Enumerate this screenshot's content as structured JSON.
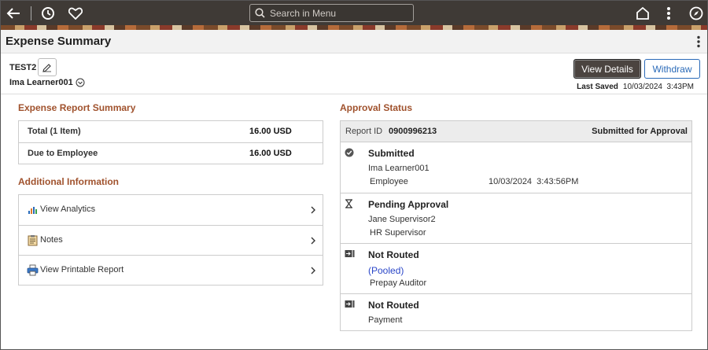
{
  "topbar": {
    "icons": [
      "back-arrow-icon",
      "history-icon",
      "heart-icon",
      "home-icon",
      "kebab-icon",
      "compass-icon"
    ],
    "search_placeholder": "Search in Menu"
  },
  "page": {
    "title": "Expense Summary"
  },
  "header": {
    "report_name": "TEST2",
    "employee": "Ima Learner001",
    "view_details_label": "View Details",
    "withdraw_label": "Withdraw",
    "last_saved_label": "Last Saved",
    "last_saved_value": "10/03/2024  3:43PM"
  },
  "summary": {
    "heading": "Expense Report Summary",
    "rows": [
      {
        "label": "Total (1 Item)",
        "value": "16.00 USD"
      },
      {
        "label": "Due to Employee",
        "value": "16.00 USD"
      }
    ]
  },
  "additional": {
    "heading": "Additional Information",
    "items": [
      {
        "label": "View Analytics",
        "icon": "analytics-icon"
      },
      {
        "label": "Notes",
        "icon": "notes-icon"
      },
      {
        "label": "View Printable Report",
        "icon": "printer-icon"
      }
    ]
  },
  "approval": {
    "heading": "Approval Status",
    "report_id_label": "Report ID",
    "report_id_value": "0900996213",
    "status": "Submitted for Approval",
    "steps": [
      {
        "name": "Submitted",
        "who": "Ima Learner001",
        "role": "Employee",
        "timestamp": "10/03/2024  3:43:56PM",
        "icon": "check-circle-icon"
      },
      {
        "name": "Pending Approval",
        "who": "Jane Supervisor2",
        "role": "HR Supervisor",
        "icon": "hourglass-icon"
      },
      {
        "name": "Not Routed",
        "who": "(Pooled)",
        "role": "Prepay Auditor",
        "icon": "not-routed-icon"
      },
      {
        "name": "Not Routed",
        "who": "Payment",
        "icon": "not-routed-icon"
      }
    ]
  }
}
